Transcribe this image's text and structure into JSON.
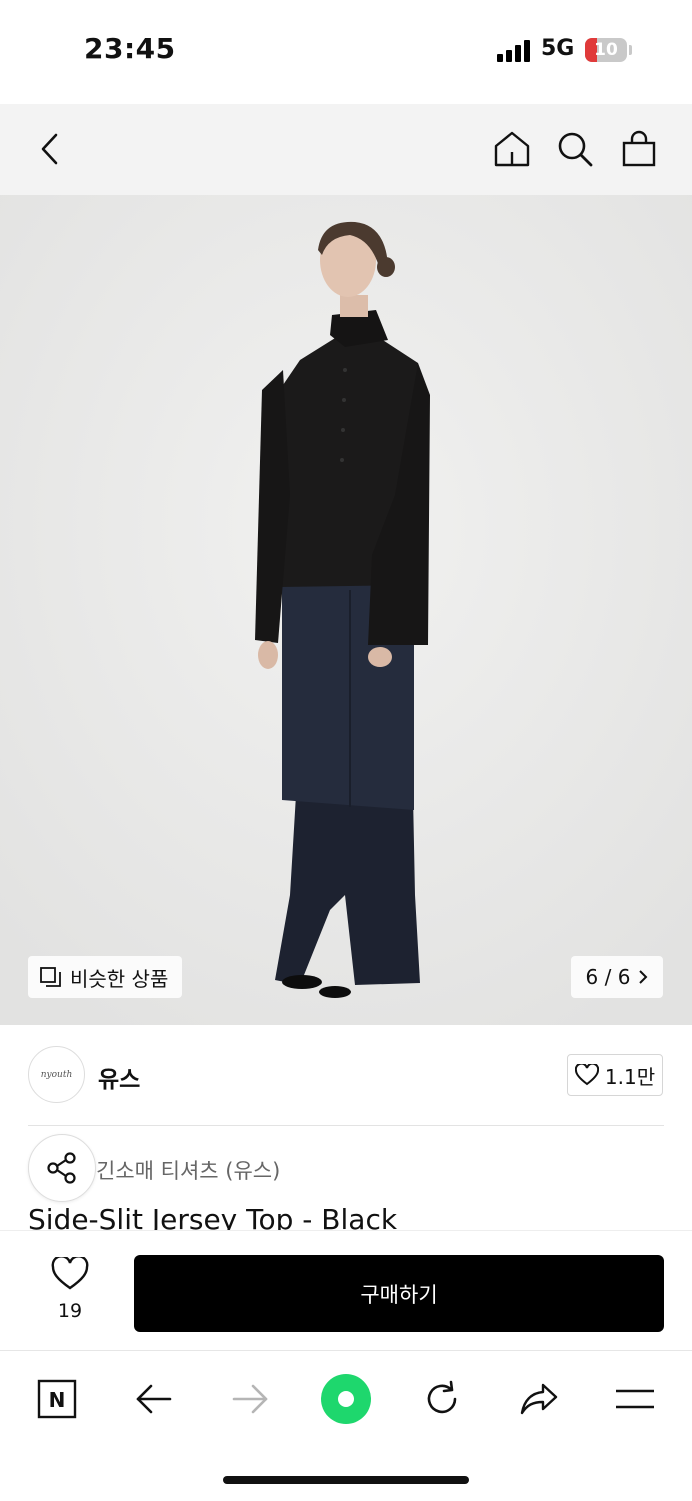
{
  "status_bar": {
    "time": "23:45",
    "network": "5G",
    "battery": "10"
  },
  "header": {
    "icons": [
      "back-arrow-icon",
      "home-icon",
      "search-icon",
      "shopping-bag-icon"
    ]
  },
  "hero": {
    "similar_label": "비슷한 상품",
    "page_indicator": "6 / 6"
  },
  "brand": {
    "logo_text": "nyouth",
    "name": "유스",
    "likes": "1.1만"
  },
  "product": {
    "category": "긴소매 티셔츠 (유스)",
    "title": "Side-Slit Jersey Top - Black"
  },
  "purchase_bar": {
    "wish_count": "19",
    "buy_label": "구매하기"
  },
  "browser_toolbar": {
    "logo_letter": "N",
    "icons": [
      "naver-n-icon",
      "back-icon",
      "forward-icon",
      "green-dot-icon",
      "reload-icon",
      "share-icon",
      "menu-icon"
    ]
  },
  "colors": {
    "accent_green": "#1ec800",
    "buy_button": "#000000",
    "battery_low": "#e03a3a"
  }
}
